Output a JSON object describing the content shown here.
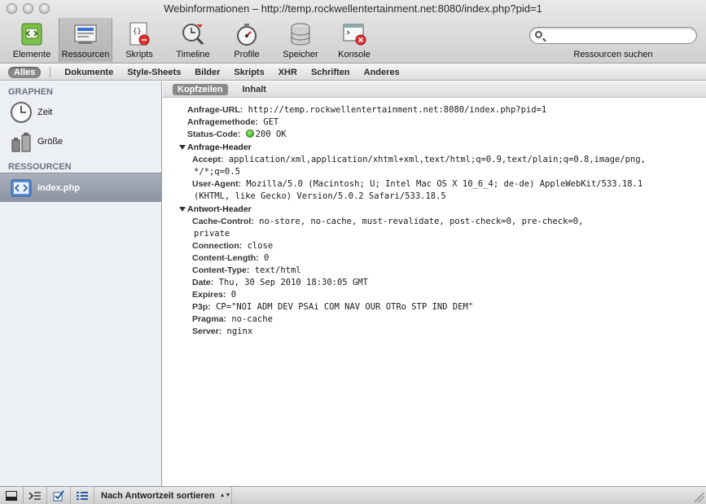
{
  "window": {
    "title": "Webinformationen – http://temp.rockwellentertainment.net:8080/index.php?pid=1"
  },
  "toolbar": {
    "tools": [
      {
        "label": "Elemente",
        "icon": "elements-icon"
      },
      {
        "label": "Ressourcen",
        "icon": "resources-icon",
        "active": true
      },
      {
        "label": "Skripts",
        "icon": "scripts-icon"
      },
      {
        "label": "Timeline",
        "icon": "timeline-icon"
      },
      {
        "label": "Profile",
        "icon": "profiles-icon"
      },
      {
        "label": "Speicher",
        "icon": "storage-icon"
      },
      {
        "label": "Konsole",
        "icon": "console-icon"
      }
    ],
    "search_label": "Ressourcen suchen",
    "search_value": ""
  },
  "filters": [
    "Alles",
    "Dokumente",
    "Style-Sheets",
    "Bilder",
    "Skripts",
    "XHR",
    "Schriften",
    "Anderes"
  ],
  "sidebar": {
    "graphs_header": "GRAPHEN",
    "graphs": [
      {
        "label": "Zeit",
        "icon": "clock-icon"
      },
      {
        "label": "Größe",
        "icon": "weights-icon"
      }
    ],
    "resources_header": "RESSOURCEN",
    "resources": [
      {
        "label": "index.php",
        "icon": "document-icon",
        "selected": true
      }
    ]
  },
  "tabs": [
    "Kopfzeilen",
    "Inhalt"
  ],
  "details": {
    "request_url_key": "Anfrage-URL:",
    "request_url": "http://temp.rockwellentertainment.net:8080/index.php?pid=1",
    "method_key": "Anfragemethode:",
    "method": "GET",
    "status_key": "Status-Code:",
    "status": "200 OK",
    "status_color": "#2b9a10",
    "request_header_title": "Anfrage-Header",
    "request_headers": [
      {
        "key": "Accept:",
        "value": "application/xml,application/xhtml+xml,text/html;q=0.9,text/plain;q=0.8,image/png,",
        "cont": "*/*;q=0.5"
      },
      {
        "key": "User-Agent:",
        "value": "Mozilla/5.0 (Macintosh; U; Intel Mac OS X 10_6_4; de-de) AppleWebKit/533.18.1",
        "cont": "(KHTML, like Gecko) Version/5.0.2 Safari/533.18.5"
      }
    ],
    "response_header_title": "Antwort-Header",
    "response_headers": [
      {
        "key": "Cache-Control:",
        "value": "no-store, no-cache, must-revalidate, post-check=0, pre-check=0,",
        "cont": "private"
      },
      {
        "key": "Connection:",
        "value": "close"
      },
      {
        "key": "Content-Length:",
        "value": "0"
      },
      {
        "key": "Content-Type:",
        "value": "text/html"
      },
      {
        "key": "Date:",
        "value": "Thu, 30 Sep 2010 18:30:05 GMT"
      },
      {
        "key": "Expires:",
        "value": "0"
      },
      {
        "key": "P3p:",
        "value": "CP=\"NOI ADM DEV PSAi COM NAV OUR OTRo STP IND DEM\""
      },
      {
        "key": "Pragma:",
        "value": "no-cache"
      },
      {
        "key": "Server:",
        "value": "nginx"
      }
    ]
  },
  "statusbar": {
    "sort_label": "Nach Antwortzeit sortieren"
  }
}
